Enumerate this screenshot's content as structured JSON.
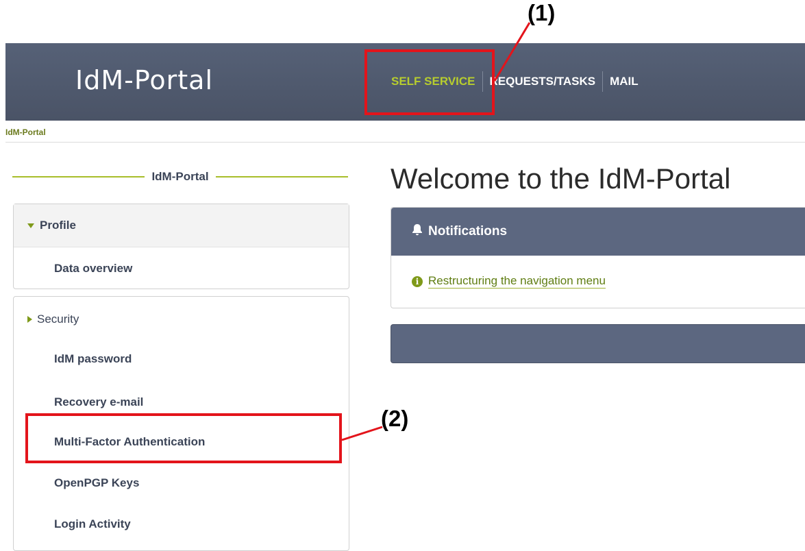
{
  "header": {
    "logo": "IdM-Portal",
    "nav": [
      "SELF SERVICE",
      "REQUESTS/TASKS",
      "MAIL"
    ],
    "active_color": "#b7cd2e"
  },
  "breadcrumb": "IdM-Portal",
  "sidebar": {
    "title": "IdM-Portal",
    "profile": {
      "label": "Profile",
      "items": [
        "Data overview"
      ]
    },
    "security": {
      "label": "Security",
      "items": [
        "IdM password",
        "Recovery e-mail",
        "Multi-Factor Authentication",
        "OpenPGP Keys",
        "Login Activity"
      ]
    }
  },
  "main": {
    "title": "Welcome to the IdM-Portal",
    "notifications": {
      "title": "Notifications",
      "link": "Restructuring the navigation menu"
    }
  },
  "annotations": {
    "first": "(1)",
    "second": "(2)",
    "color": "#e3141b"
  }
}
